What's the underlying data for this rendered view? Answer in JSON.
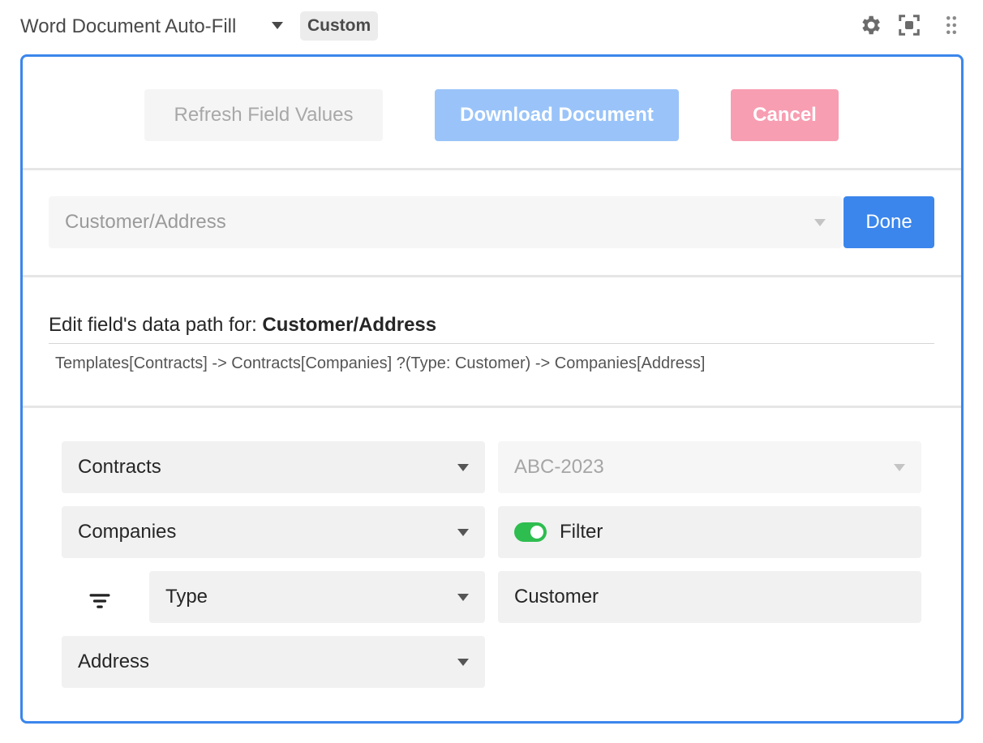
{
  "header": {
    "title": "Word Document Auto-Fill",
    "badge": "Custom",
    "icons": [
      "gear-icon",
      "focus-icon",
      "drag-handle-icon"
    ]
  },
  "toolbar": {
    "refresh_label": "Refresh Field Values",
    "download_label": "Download Document",
    "cancel_label": "Cancel"
  },
  "field": {
    "selected": "Customer/Address",
    "done_label": "Done"
  },
  "editor": {
    "label_prefix": "Edit field's data path for: ",
    "field_name": "Customer/Address",
    "path": "Templates[Contracts] -> Contracts[Companies] ?(Type: Customer) -> Companies[Address]"
  },
  "path_builder": {
    "row1": {
      "table": "Contracts",
      "record": "ABC-2023"
    },
    "row2": {
      "table": "Companies",
      "filter_label": "Filter",
      "filter_enabled": true
    },
    "row3": {
      "filter_field": "Type",
      "filter_value": "Customer"
    },
    "row4": {
      "field": "Address"
    }
  },
  "colors": {
    "accent": "#3b86ec",
    "download": "#9ac4f9",
    "cancel": "#f89eb2",
    "toggle_on": "#2ebd4f"
  }
}
